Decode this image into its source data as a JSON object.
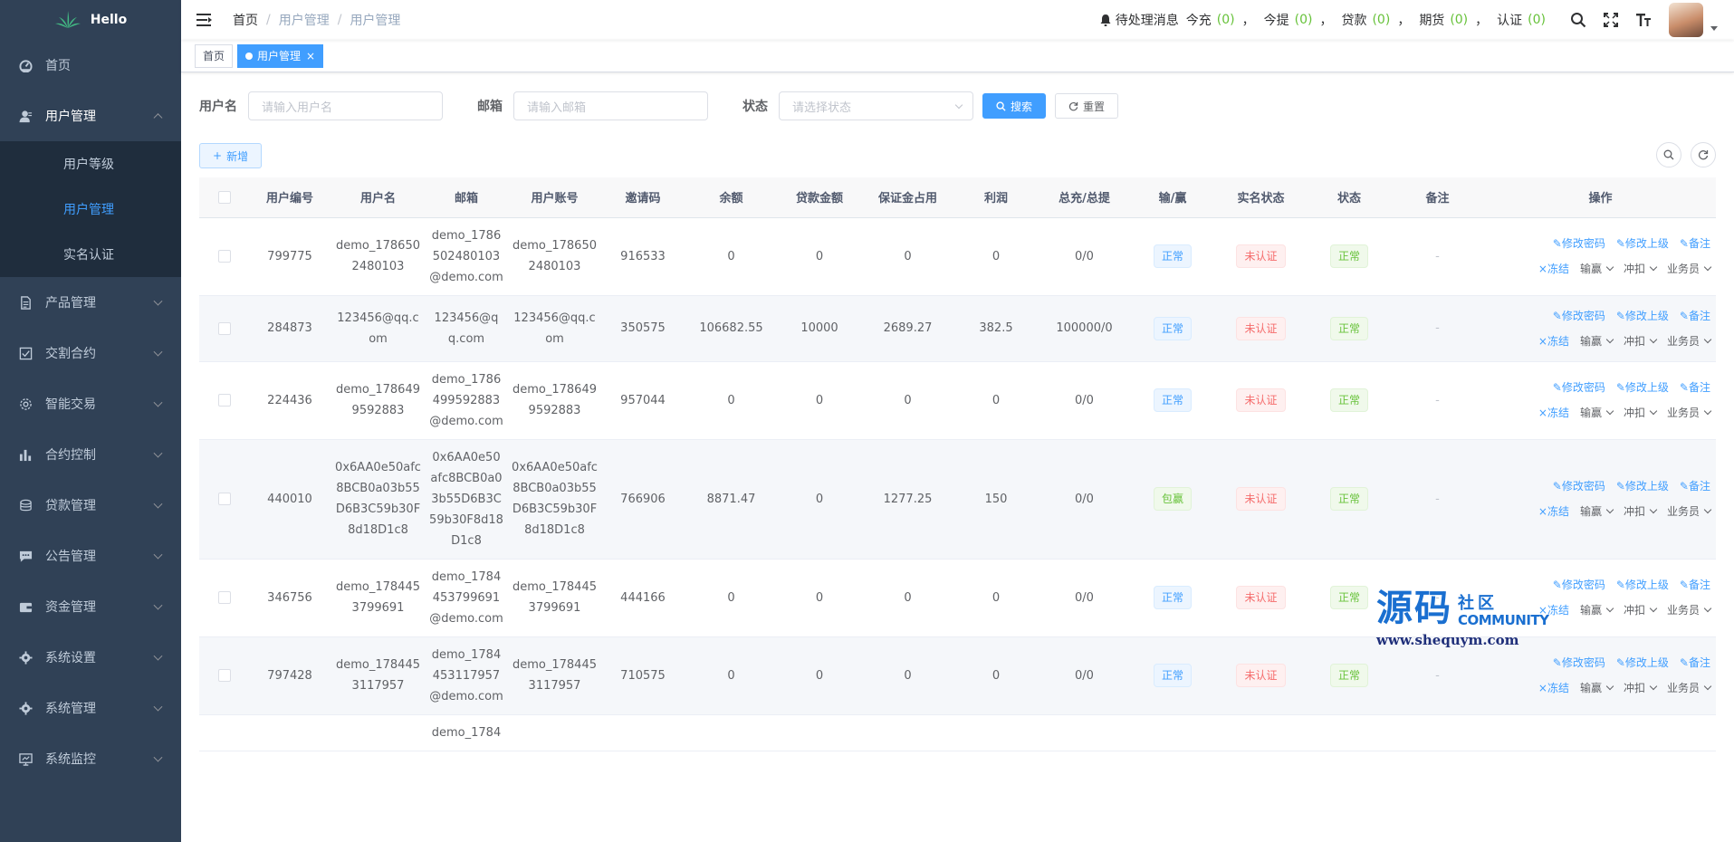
{
  "logo": {
    "text": "Hello"
  },
  "sidebar": {
    "items": [
      {
        "label": "首页",
        "icon": "dashboard-icon",
        "arrow": "none"
      },
      {
        "label": "用户管理",
        "icon": "user-icon",
        "arrow": "up",
        "open": true,
        "children": [
          {
            "label": "用户等级",
            "active": false
          },
          {
            "label": "用户管理",
            "active": true
          },
          {
            "label": "实名认证",
            "active": false
          }
        ]
      },
      {
        "label": "产品管理",
        "icon": "document-icon",
        "arrow": "down"
      },
      {
        "label": "交割合约",
        "icon": "checkbox-icon",
        "arrow": "down"
      },
      {
        "label": "智能交易",
        "icon": "gear-small-icon",
        "arrow": "down"
      },
      {
        "label": "合约控制",
        "icon": "bar-chart-icon",
        "arrow": "down"
      },
      {
        "label": "贷款管理",
        "icon": "money-icon",
        "arrow": "down"
      },
      {
        "label": "公告管理",
        "icon": "message-icon",
        "arrow": "down"
      },
      {
        "label": "资金管理",
        "icon": "wallet-icon",
        "arrow": "down"
      },
      {
        "label": "系统设置",
        "icon": "settings-icon",
        "arrow": "down"
      },
      {
        "label": "系统管理",
        "icon": "system-icon",
        "arrow": "down"
      },
      {
        "label": "系统监控",
        "icon": "monitor-icon",
        "arrow": "down"
      }
    ]
  },
  "header": {
    "breadcrumb": [
      "首页",
      "用户管理",
      "用户管理"
    ],
    "notif_title": "待处理消息",
    "notif": [
      {
        "label": "今充",
        "count": "(0)"
      },
      {
        "label": "今提",
        "count": "(0)"
      },
      {
        "label": "贷款",
        "count": "(0)"
      },
      {
        "label": "期货",
        "count": "(0)"
      },
      {
        "label": "认证",
        "count": "(0)"
      }
    ],
    "comma": "，"
  },
  "tags": [
    {
      "label": "首页",
      "active": false
    },
    {
      "label": "用户管理",
      "active": true,
      "close": "×"
    }
  ],
  "search": {
    "username_label": "用户名",
    "username_placeholder": "请输入用户名",
    "email_label": "邮箱",
    "email_placeholder": "请输入邮箱",
    "status_label": "状态",
    "status_placeholder": "请选择状态",
    "search_button": "搜索",
    "reset_button": "重置"
  },
  "toolbar": {
    "add_button": "新增"
  },
  "table": {
    "headers": [
      "用户编号",
      "用户名",
      "邮箱",
      "用户账号",
      "邀请码",
      "余额",
      "贷款金额",
      "保证金占用",
      "利润",
      "总充/总提",
      "输/赢",
      "实名状态",
      "状态",
      "备注",
      "操作"
    ],
    "rows": [
      {
        "id": "799775",
        "username": "demo_1786502480103",
        "email": "demo_1786502480103@demo.com",
        "account": "demo_1786502480103",
        "invite": "916533",
        "balance": "0",
        "loan": "0",
        "margin": "0",
        "profit": "0",
        "total": "0/0",
        "winlose": "正常",
        "winlose_color": "blue",
        "realname": "未认证",
        "status": "正常",
        "remark": "-"
      },
      {
        "id": "284873",
        "username": "123456@qq.com",
        "email": "123456@qq.com",
        "account": "123456@qq.com",
        "invite": "350575",
        "balance": "106682.55",
        "loan": "10000",
        "margin": "2689.27",
        "profit": "382.5",
        "total": "100000/0",
        "winlose": "正常",
        "winlose_color": "blue",
        "realname": "未认证",
        "status": "正常",
        "remark": "-"
      },
      {
        "id": "224436",
        "username": "demo_1786499592883",
        "email": "demo_1786499592883@demo.com",
        "account": "demo_1786499592883",
        "invite": "957044",
        "balance": "0",
        "loan": "0",
        "margin": "0",
        "profit": "0",
        "total": "0/0",
        "winlose": "正常",
        "winlose_color": "blue",
        "realname": "未认证",
        "status": "正常",
        "remark": "-"
      },
      {
        "id": "440010",
        "username": "0x6AA0e50afc8BCB0a03b55D6B3C59b30F8d18D1c8",
        "email": "0x6AA0e50afc8BCB0a03b55D6B3C59b30F8d18D1c8",
        "account": "0x6AA0e50afc8BCB0a03b55D6B3C59b30F8d18D1c8",
        "invite": "766906",
        "balance": "8871.47",
        "loan": "0",
        "margin": "1277.25",
        "profit": "150",
        "total": "0/0",
        "winlose": "包赢",
        "winlose_color": "green",
        "realname": "未认证",
        "status": "正常",
        "remark": "-"
      },
      {
        "id": "346756",
        "username": "demo_1784453799691",
        "email": "demo_1784453799691@demo.com",
        "account": "demo_1784453799691",
        "invite": "444166",
        "balance": "0",
        "loan": "0",
        "margin": "0",
        "profit": "0",
        "total": "0/0",
        "winlose": "正常",
        "winlose_color": "blue",
        "realname": "未认证",
        "status": "正常",
        "remark": "-"
      },
      {
        "id": "797428",
        "username": "demo_1784453117957",
        "email": "demo_1784453117957@demo.com",
        "account": "demo_1784453117957",
        "invite": "710575",
        "balance": "0",
        "loan": "0",
        "margin": "0",
        "profit": "0",
        "total": "0/0",
        "winlose": "正常",
        "winlose_color": "blue",
        "realname": "未认证",
        "status": "正常",
        "remark": "-"
      },
      {
        "id": "",
        "username": "",
        "email": "demo_1784",
        "account": "",
        "invite": "",
        "balance": "",
        "loan": "",
        "margin": "",
        "profit": "",
        "total": "",
        "winlose": "",
        "winlose_color": "",
        "realname": "",
        "status": "",
        "remark": "",
        "partial": true
      }
    ],
    "ops": {
      "change_password": "修改密码",
      "change_parent": "修改上级",
      "remark": "备注",
      "freeze": "冻结",
      "winlose": "输赢",
      "adjust": "冲扣",
      "salesman": "业务员"
    }
  },
  "watermark": {
    "big": "源码",
    "cn": "社区",
    "en": "COMMUNITY",
    "url": "www.shequym.com"
  },
  "colors": {
    "sidebar_bg": "#304156",
    "submenu_bg": "#1f2d3d",
    "primary": "#409eff",
    "success": "#67c23a",
    "danger": "#f56c6c"
  }
}
